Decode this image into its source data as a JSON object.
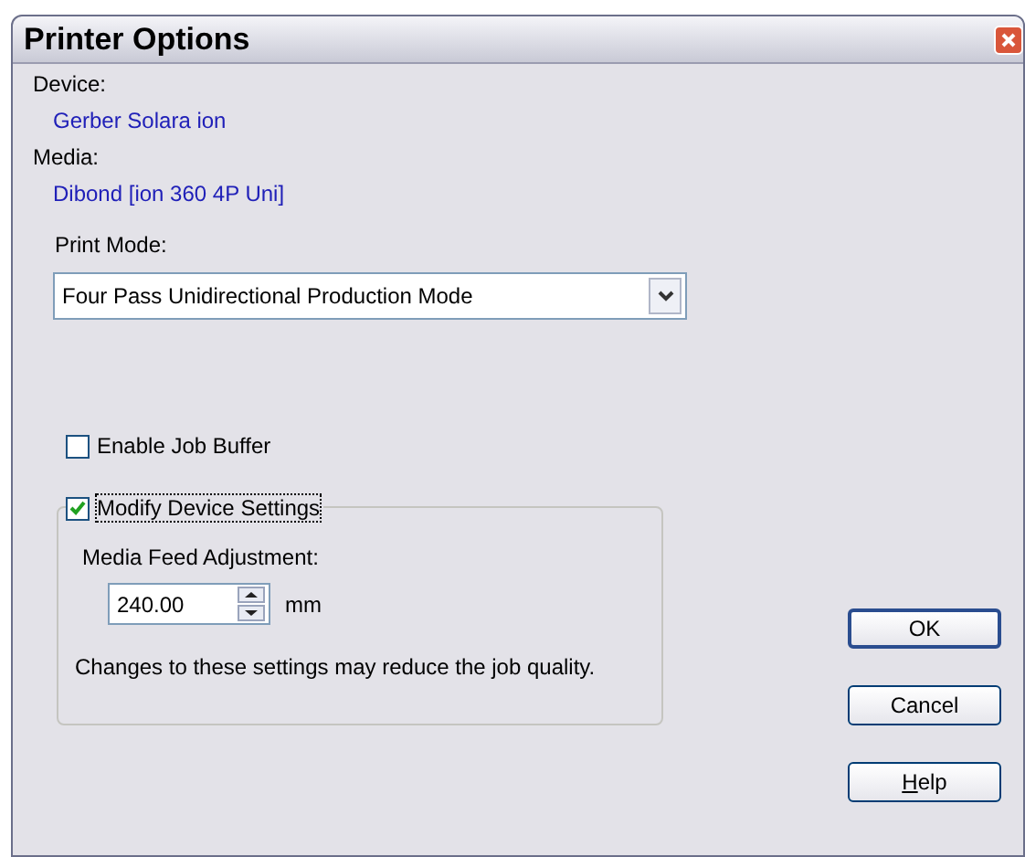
{
  "window": {
    "title": "Printer Options"
  },
  "device": {
    "label": "Device:",
    "value": "Gerber Solara ion"
  },
  "media": {
    "label": "Media:",
    "value": "Dibond [ion 360 4P Uni]"
  },
  "print_mode": {
    "label": "Print Mode:",
    "value": "Four Pass Unidirectional Production Mode"
  },
  "enable_job_buffer": {
    "label": "Enable Job Buffer",
    "checked": false
  },
  "modify_device_settings": {
    "label": "Modify Device Settings",
    "checked": true,
    "feed_label": "Media Feed Adjustment:",
    "feed_value": "240.00",
    "unit": "mm",
    "warning": "Changes to these settings may reduce the job quality."
  },
  "buttons": [
    {
      "label": "OK",
      "default": true
    },
    {
      "label": "Cancel",
      "default": false
    },
    {
      "label": "Help",
      "default": false,
      "access_key": true
    }
  ]
}
